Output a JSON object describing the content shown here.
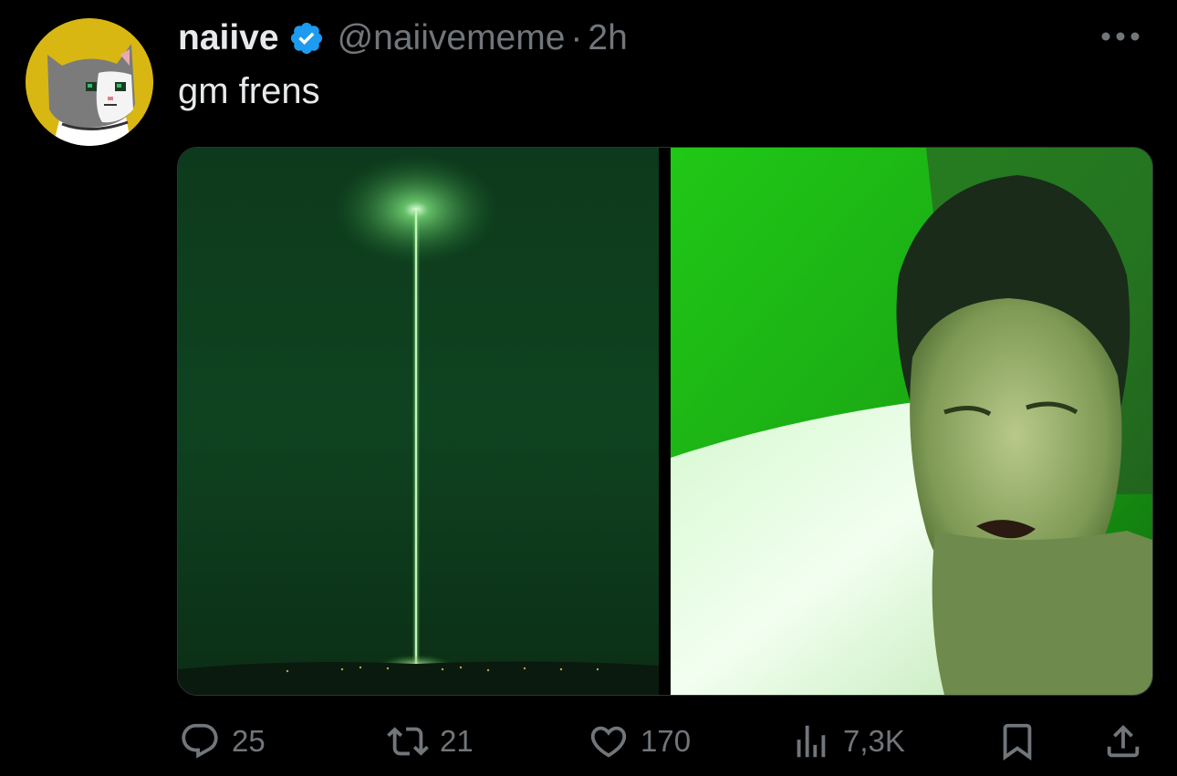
{
  "tweet": {
    "display_name": "naiive",
    "handle": "@naiivememe",
    "separator": "·",
    "time": "2h",
    "text": "gm frens"
  },
  "stats": {
    "replies": "25",
    "reposts": "21",
    "likes": "170",
    "views": "7,3K"
  },
  "colors": {
    "background": "#000000",
    "text_primary": "#e7e9ea",
    "text_secondary": "#71767b",
    "verified_badge": "#1d9bf0",
    "avatar_bg": "#d8b713"
  },
  "icons": {
    "more": "more-horizontal-icon",
    "verified": "verified-badge-icon",
    "reply": "reply-icon",
    "repost": "repost-icon",
    "like": "heart-icon",
    "views": "bar-chart-icon",
    "bookmark": "bookmark-icon",
    "share": "share-icon"
  }
}
